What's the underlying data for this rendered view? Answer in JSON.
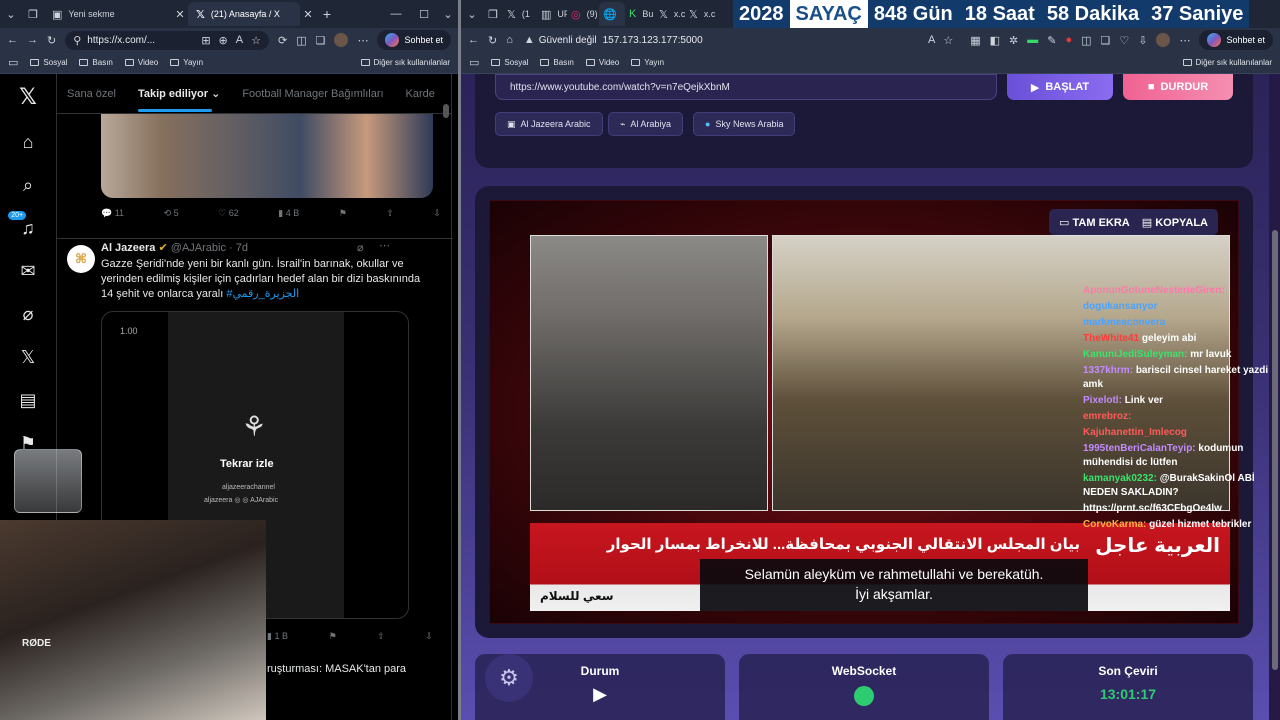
{
  "left": {
    "tabs": [
      {
        "label": "Yeni sekme"
      },
      {
        "label": "(21) Anasayfa / X"
      }
    ],
    "url": "https://x.com/...",
    "copilot_label": "Sohbet et",
    "favorites": [
      "Sosyal",
      "Basın",
      "Video",
      "Yayın"
    ],
    "favorites_other": "Diğer sık kullanılanlar",
    "x": {
      "tabs": [
        "Sana özel",
        "Takip ediliyor",
        "Football Manager Bağımlıları",
        "Karde"
      ],
      "notif_badge": "20+",
      "post1_actions": {
        "replies": "11",
        "reposts": "5",
        "likes": "62",
        "views": "4 B"
      },
      "tweet": {
        "author": "Al Jazeera",
        "handle": "@AJArabic",
        "age": "· 7d",
        "text": "Gazze Şeridi'nde yeni bir kanlı gün. İsrail'in barınak, okullar ve yerinden edilmiş kişiler için çadırları hedef alan bir dizi baskınında 14 şehit ve onlarca yaralı",
        "hashtag": "#الجزيرة_رقمي",
        "video_time": "1.00",
        "replay": "Tekrar izle",
        "video_credit1": "aljazeerachannel",
        "video_credit2": "aljazeera ◎ ◎ AJArabic",
        "views": "1 B"
      },
      "next_post_text": "ruşturması: MASAK'tan para"
    }
  },
  "right": {
    "tabs": [
      "(1",
      "UF",
      "(9)",
      "",
      "Bu",
      "x.c",
      "x.c"
    ],
    "url_security": "Güvenli değil",
    "url": "157.173.123.177:5000",
    "copilot_label": "Sohbet et",
    "favorites": [
      "Sosyal",
      "Basın",
      "Video",
      "Yayın"
    ],
    "favorites_other": "Diğer sık kullanılanlar",
    "counter": {
      "year": "2028",
      "label": "SAYAÇ",
      "days": "848 Gün",
      "hours": "18 Saat",
      "minutes": "58 Dakika",
      "seconds": "37 Saniye"
    },
    "app": {
      "stream_url": "https://www.youtube.com/watch?v=n7eQejkXbnM",
      "start_label": "BAŞLAT",
      "stop_label": "DURDUR",
      "channels": [
        "Al Jazeera Arabic",
        "Al Arabiya",
        "Sky News Arabia"
      ],
      "fullscreen_label": "TAM EKRA",
      "copy_label": "KOPYALA",
      "news_ticker_top": "بيان المجلس الانتقالي الجنوبي بمحافظة... للانخراط بمسار الحوار",
      "news_ticker_brand": "العربية عاجل",
      "news_ticker_bottom": "سعي للسلام",
      "subtitle_line1": "Selamün aleyküm ve rahmetullahi ve berekatüh.",
      "subtitle_line2": "İyi akşamlar.",
      "status": [
        {
          "title": "Durum"
        },
        {
          "title": "WebSocket"
        },
        {
          "title": "Son Çeviri",
          "value": "13:01:17"
        }
      ],
      "colors": {
        "accent": "#6a4fd8",
        "stop": "#f06292",
        "ws_ok": "#2ecc71"
      }
    },
    "chat": [
      {
        "user": "AponunGotuneNesterieGiren:",
        "msg": "",
        "color": "#ff77aa"
      },
      {
        "user": "dogukansanyor",
        "msg": "",
        "color": "#4aa3ff"
      },
      {
        "user": "markmeaconvera",
        "msg": "",
        "color": "#4aa3ff"
      },
      {
        "user": "TheWhite41",
        "msg": "geleyim abi",
        "color": "#ff3b3b"
      },
      {
        "user": "KanuniJediSuleyman:",
        "msg": "mr lavuk",
        "color": "#3be36b"
      },
      {
        "user": "1337khrm:",
        "msg": "bariscil cinsel hareket yazdi amk",
        "color": "#c38bff"
      },
      {
        "user": "Pixelotl:",
        "msg": "Link ver",
        "color": "#c38bff"
      },
      {
        "user": "emrebroz:",
        "msg": "",
        "color": "#ff5a5a"
      },
      {
        "user": "Kajuhanettin_Imlecog",
        "msg": "",
        "color": "#ff5a5a"
      },
      {
        "user": "1995tenBeriCalanTeyip:",
        "msg": "kodumun mühendisi dc lütfen",
        "color": "#c38bff"
      },
      {
        "user": "kamanyak0232:",
        "msg": "@BurakSakinOl ABİ NEDEN SAKLADIN?",
        "color": "#3be36b"
      },
      {
        "user": "",
        "msg": "https://prnt.sc/f63CFbgOe4lw",
        "color": "#ffffff"
      },
      {
        "user": "CorvoKarma:",
        "msg": "güzel hizmet tebrikler",
        "color": "#ffb347"
      }
    ],
    "cam_brand": "RØDE"
  }
}
